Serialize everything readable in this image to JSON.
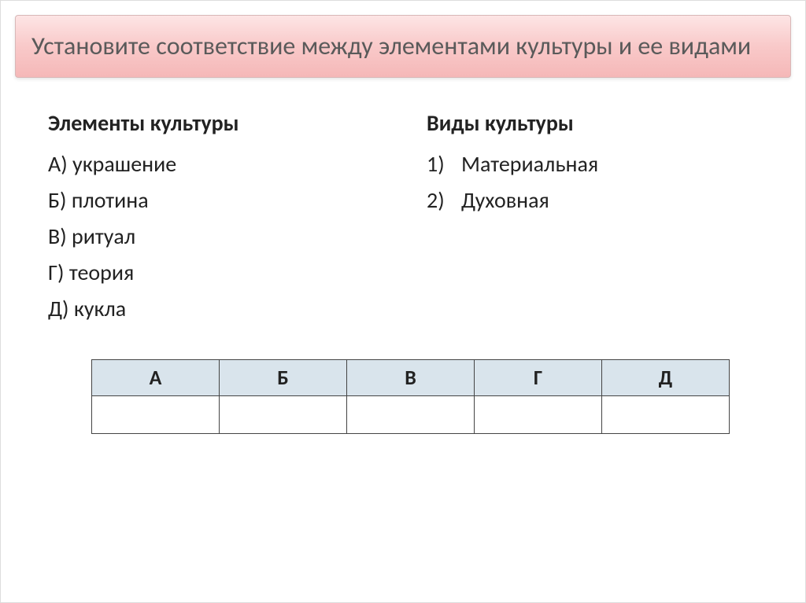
{
  "title": "Установите соответствие между элементами культуры и ее видами",
  "left": {
    "heading": "Элементы культуры",
    "items": [
      "А) украшение",
      "Б) плотина",
      "В) ритуал",
      "Г) теория",
      "Д) кукла"
    ]
  },
  "right": {
    "heading": "Виды культуры",
    "items": [
      {
        "num": "1)",
        "text": "Материальная"
      },
      {
        "num": "2)",
        "text": "Духовная"
      }
    ]
  },
  "table": {
    "headers": [
      "А",
      "Б",
      "В",
      "Г",
      "Д"
    ],
    "answers": [
      "",
      "",
      "",
      "",
      ""
    ]
  }
}
